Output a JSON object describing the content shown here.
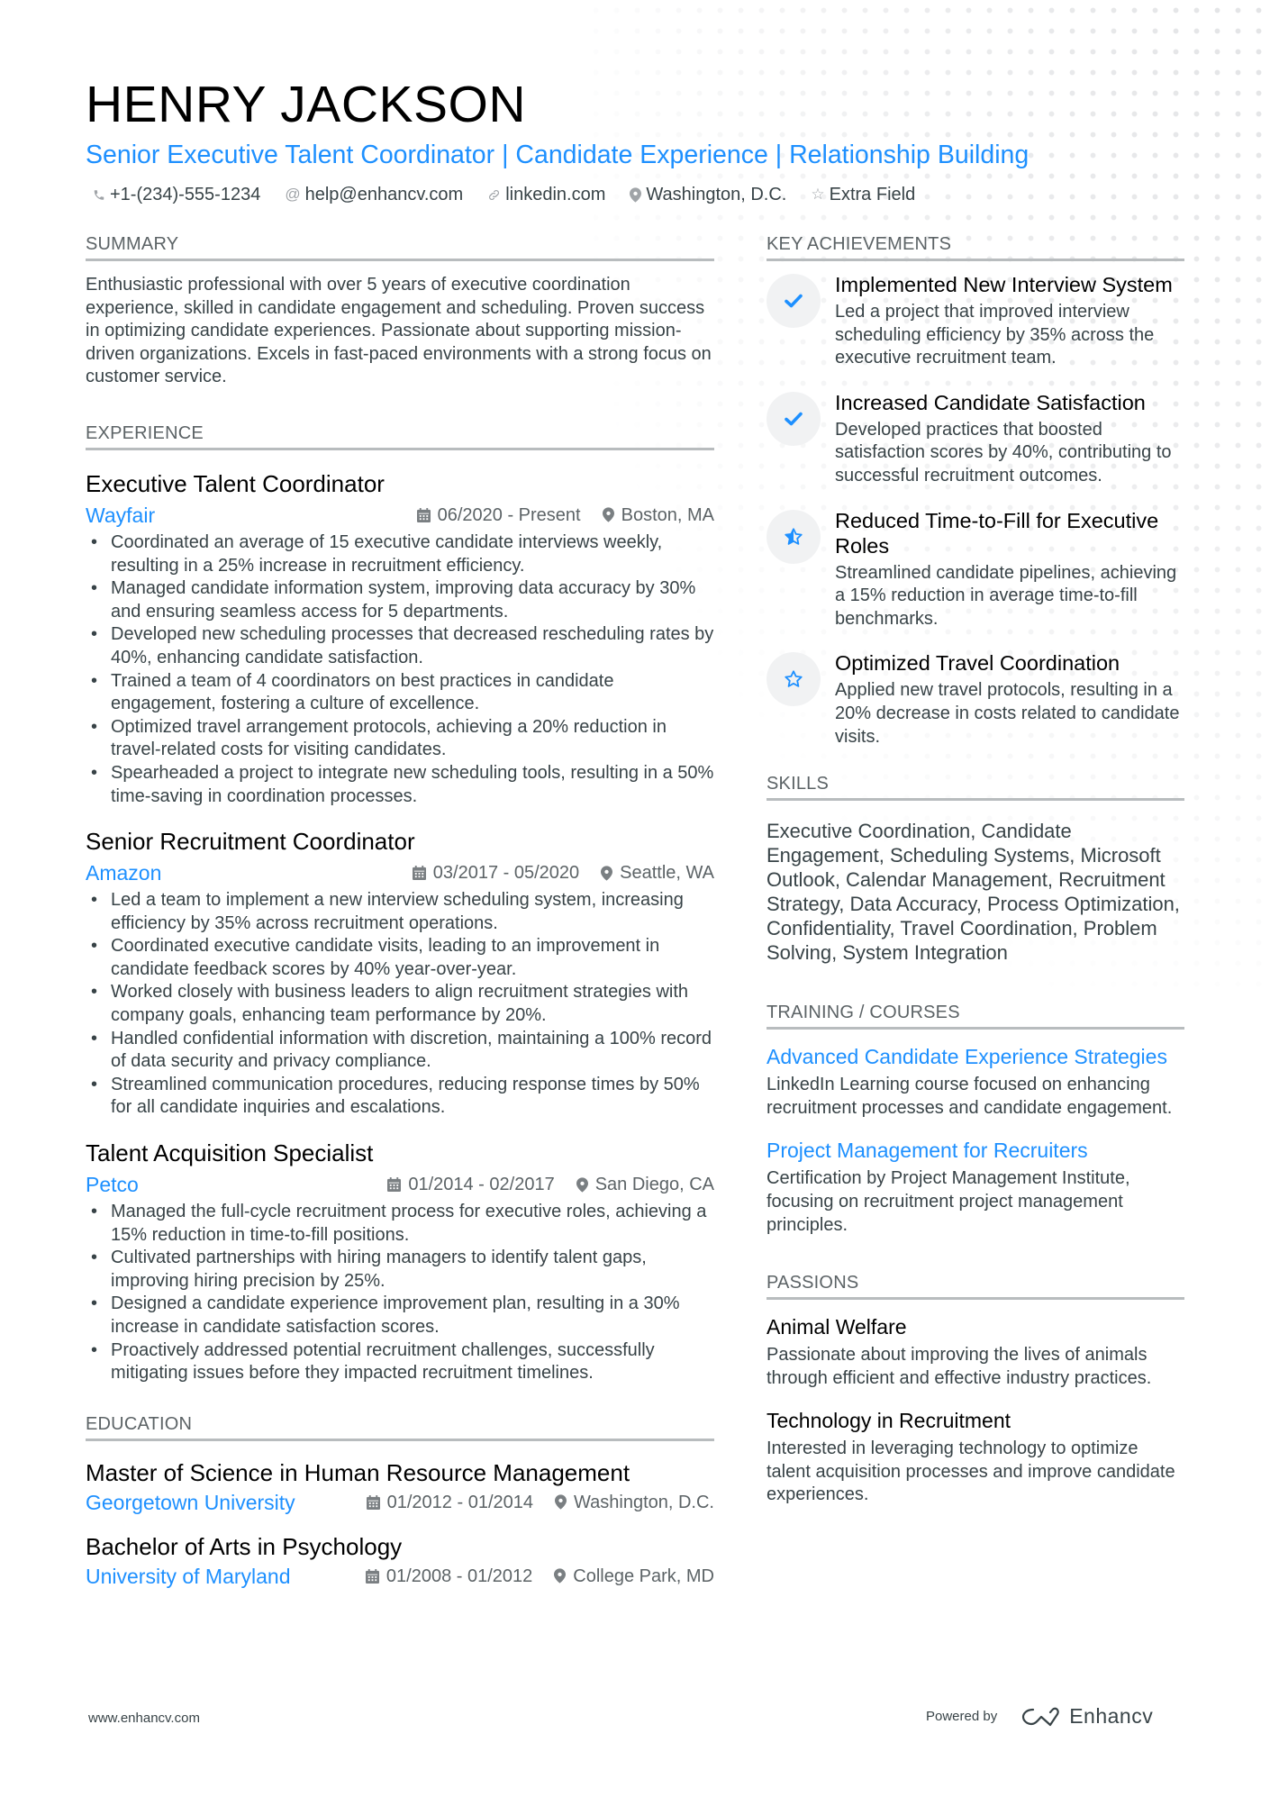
{
  "header": {
    "name": "HENRY JACKSON",
    "headline": "Senior Executive Talent Coordinator | Candidate Experience | Relationship Building",
    "contacts": [
      {
        "icon": "phone-icon",
        "text": "+1-(234)-555-1234"
      },
      {
        "icon": "at-icon",
        "text": "help@enhancv.com"
      },
      {
        "icon": "link-icon",
        "text": "linkedin.com"
      },
      {
        "icon": "location-icon",
        "text": "Washington, D.C."
      },
      {
        "icon": "star-icon",
        "text": "Extra Field"
      }
    ]
  },
  "summary": {
    "title": "SUMMARY",
    "text": "Enthusiastic professional with over 5 years of executive coordination experience, skilled in candidate engagement and scheduling. Proven success in optimizing candidate experiences. Passionate about supporting mission-driven organizations. Excels in fast-paced environments with a strong focus on customer service."
  },
  "experience": {
    "title": "EXPERIENCE",
    "jobs": [
      {
        "title": "Executive Talent Coordinator",
        "company": "Wayfair",
        "dates": "06/2020 - Present",
        "location": "Boston, MA",
        "bullets": [
          "Coordinated an average of 15 executive candidate interviews weekly, resulting in a 25% increase in recruitment efficiency.",
          "Managed candidate information system, improving data accuracy by 30% and ensuring seamless access for 5 departments.",
          "Developed new scheduling processes that decreased rescheduling rates by 40%, enhancing candidate satisfaction.",
          "Trained a team of 4 coordinators on best practices in candidate engagement, fostering a culture of excellence.",
          "Optimized travel arrangement protocols, achieving a 20% reduction in travel-related costs for visiting candidates.",
          "Spearheaded a project to integrate new scheduling tools, resulting in a 50% time-saving in coordination processes."
        ]
      },
      {
        "title": "Senior Recruitment Coordinator",
        "company": "Amazon",
        "dates": "03/2017 - 05/2020",
        "location": "Seattle, WA",
        "bullets": [
          "Led a team to implement a new interview scheduling system, increasing efficiency by 35% across recruitment operations.",
          "Coordinated executive candidate visits, leading to an improvement in candidate feedback scores by 40% year-over-year.",
          "Worked closely with business leaders to align recruitment strategies with company goals, enhancing team performance by 20%.",
          "Handled confidential information with discretion, maintaining a 100% record of data security and privacy compliance.",
          "Streamlined communication procedures, reducing response times by 50% for all candidate inquiries and escalations."
        ]
      },
      {
        "title": "Talent Acquisition Specialist",
        "company": "Petco",
        "dates": "01/2014 - 02/2017",
        "location": "San Diego, CA",
        "bullets": [
          "Managed the full-cycle recruitment process for executive roles, achieving a 15% reduction in time-to-fill positions.",
          "Cultivated partnerships with hiring managers to identify talent gaps, improving hiring precision by 25%.",
          "Designed a candidate experience improvement plan, resulting in a 30% increase in candidate satisfaction scores.",
          "Proactively addressed potential recruitment challenges, successfully mitigating issues before they impacted recruitment timelines."
        ]
      }
    ]
  },
  "education": {
    "title": "EDUCATION",
    "items": [
      {
        "degree": "Master of Science in Human Resource Management",
        "school": "Georgetown University",
        "dates": "01/2012 - 01/2014",
        "location": "Washington, D.C."
      },
      {
        "degree": "Bachelor of Arts in Psychology",
        "school": "University of Maryland",
        "dates": "01/2008 - 01/2012",
        "location": "College Park, MD"
      }
    ]
  },
  "achievements": {
    "title": "KEY ACHIEVEMENTS",
    "items": [
      {
        "icon": "check-icon",
        "title": "Implemented New Interview System",
        "desc": "Led a project that improved interview scheduling efficiency by 35% across the executive recruitment team."
      },
      {
        "icon": "check-icon",
        "title": "Increased Candidate Satisfaction",
        "desc": "Developed practices that boosted satisfaction scores by 40%, contributing to successful recruitment outcomes."
      },
      {
        "icon": "half-star-icon",
        "title": "Reduced Time-to-Fill for Executive Roles",
        "desc": "Streamlined candidate pipelines, achieving a 15% reduction in average time-to-fill benchmarks."
      },
      {
        "icon": "star-outline-icon",
        "title": "Optimized Travel Coordination",
        "desc": "Applied new travel protocols, resulting in a 20% decrease in costs related to candidate visits."
      }
    ]
  },
  "skills": {
    "title": "SKILLS",
    "text": "Executive Coordination, Candidate Engagement, Scheduling Systems, Microsoft Outlook, Calendar Management, Recruitment Strategy, Data Accuracy, Process Optimization, Confidentiality, Travel Coordination, Problem Solving, System Integration"
  },
  "training": {
    "title": "TRAINING / COURSES",
    "items": [
      {
        "title": "Advanced Candidate Experience Strategies",
        "desc": "LinkedIn Learning course focused on enhancing recruitment processes and candidate engagement."
      },
      {
        "title": "Project Management for Recruiters",
        "desc": "Certification by Project Management Institute, focusing on recruitment project management principles."
      }
    ]
  },
  "passions": {
    "title": "PASSIONS",
    "items": [
      {
        "title": "Animal Welfare",
        "desc": "Passionate about improving the lives of animals through efficient and effective industry practices."
      },
      {
        "title": "Technology in Recruitment",
        "desc": "Interested in leveraging technology to optimize talent acquisition processes and improve candidate experiences."
      }
    ]
  },
  "footer": {
    "website": "www.enhancv.com",
    "powered_by": "Powered by",
    "brand": "Enhancv"
  },
  "colors": {
    "accent": "#1e90ff",
    "text": "#384347",
    "heading": "#000000",
    "section_rule": "#b8bcbe"
  }
}
